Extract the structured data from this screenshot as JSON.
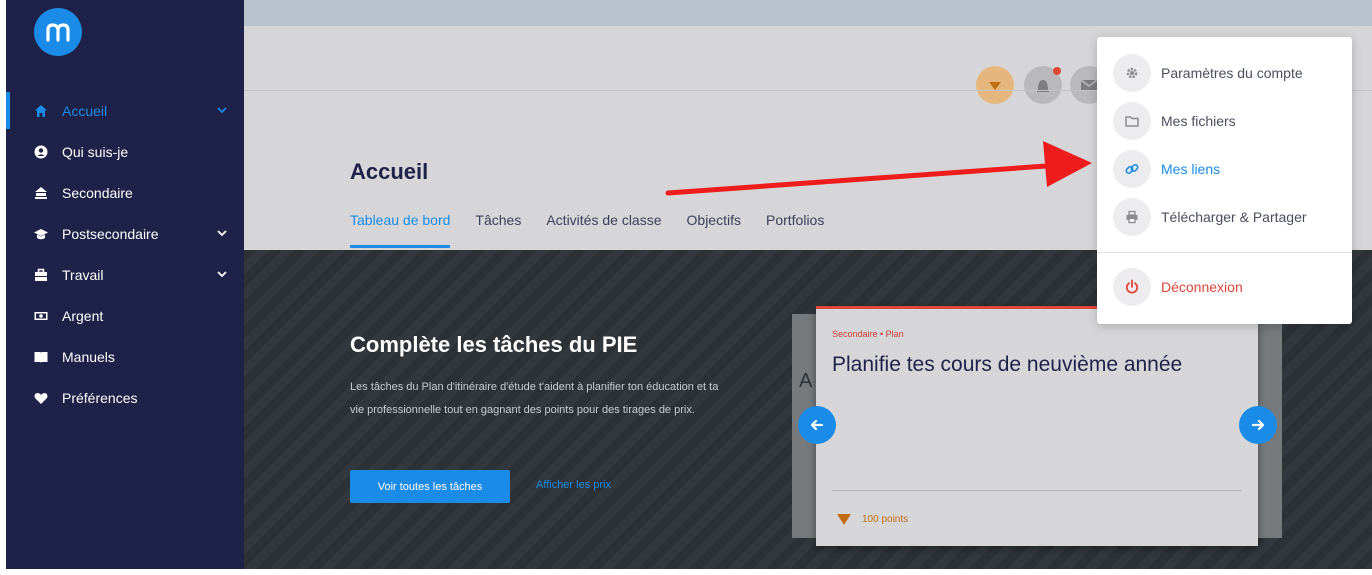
{
  "sidebar": {
    "logo_letter": "m",
    "items": [
      {
        "label": "Accueil",
        "icon": "home-icon",
        "active": true,
        "has_chevron": true
      },
      {
        "label": "Qui suis-je",
        "icon": "user-circle-icon",
        "active": false,
        "has_chevron": false
      },
      {
        "label": "Secondaire",
        "icon": "school-icon",
        "active": false,
        "has_chevron": false
      },
      {
        "label": "Postsecondaire",
        "icon": "graduation-cap-icon",
        "active": false,
        "has_chevron": true
      },
      {
        "label": "Travail",
        "icon": "briefcase-icon",
        "active": false,
        "has_chevron": true
      },
      {
        "label": "Argent",
        "icon": "money-icon",
        "active": false,
        "has_chevron": false
      },
      {
        "label": "Manuels",
        "icon": "book-icon",
        "active": false,
        "has_chevron": false
      },
      {
        "label": "Préférences",
        "icon": "heart-icon",
        "active": false,
        "has_chevron": false
      }
    ]
  },
  "header": {
    "page_title": "Accueil",
    "tabs": [
      {
        "label": "Tableau de bord",
        "active": true
      },
      {
        "label": "Tâches",
        "active": false
      },
      {
        "label": "Activités de classe",
        "active": false
      },
      {
        "label": "Objectifs",
        "active": false
      },
      {
        "label": "Portfolios",
        "active": false
      }
    ]
  },
  "hero": {
    "title": "Complète les tâches du PIE",
    "description": "Les tâches du Plan d'itinéraire d'étude t'aident à planifier ton éducation et ta vie professionnelle tout en gagnant des points pour des tirages de prix.",
    "primary_button": "Voir toutes les tâches",
    "secondary_link": "Afficher les prix"
  },
  "card": {
    "tag": "Secondaire • Plan",
    "title": "Planifie tes cours de neuvième année",
    "points": "100 points",
    "back_peek": "A"
  },
  "dropdown": {
    "items": [
      {
        "label": "Paramètres du compte",
        "icon": "gear-icon"
      },
      {
        "label": "Mes fichiers",
        "icon": "folder-icon"
      },
      {
        "label": "Mes liens",
        "icon": "link-icon"
      },
      {
        "label": "Télécharger & Partager",
        "icon": "printer-icon"
      }
    ],
    "logout": {
      "label": "Déconnexion",
      "icon": "power-icon"
    }
  },
  "colors": {
    "accent": "#1a8be6",
    "sidebar_bg": "#1e2248",
    "danger": "#e0453a",
    "points": "#c06d12",
    "annotation_arrow": "#ee1c1c"
  }
}
